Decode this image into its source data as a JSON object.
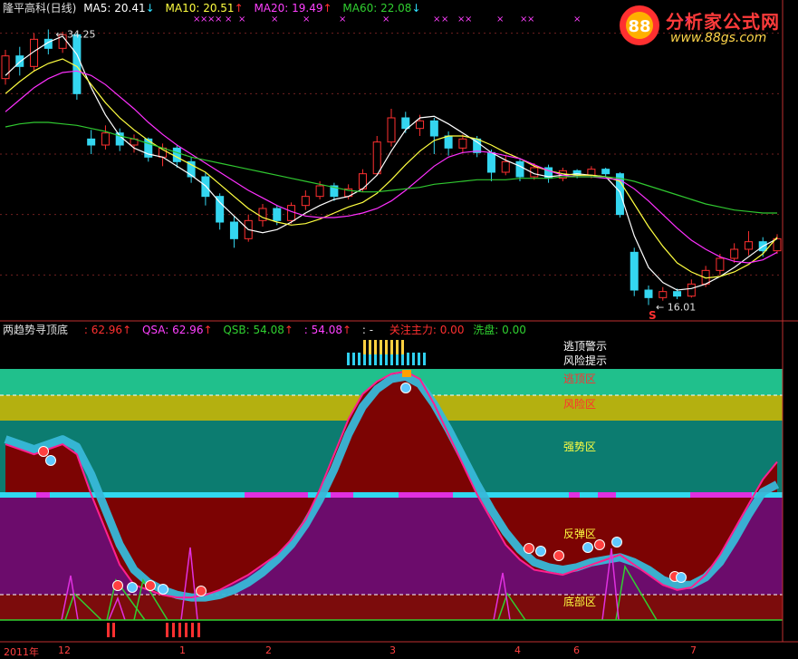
{
  "top_header": {
    "name": "隆平高科(日线)",
    "ma5_label": "MA5: 20.41",
    "ma5_arrow": "↓",
    "ma10_label": "MA10: 20.51",
    "ma10_arrow": "↑",
    "ma20_label": "MA20: 19.49",
    "ma20_arrow": "↑",
    "ma60_label": "MA60: 22.08",
    "ma60_arrow": "↓"
  },
  "logo": {
    "title": "分析家公式网",
    "url": "www.88gs.com",
    "mark_char": "88"
  },
  "top_marks": {
    "high_label": "34.25",
    "low_label": "16.01",
    "s_mark": "S"
  },
  "sub_header": {
    "name": "两趋势寻顶底",
    "v1_label": ": 62.96",
    "v1_arrow": "↑",
    "qsa_label": "QSA: 62.96",
    "qsa_arrow": "↑",
    "qsb_label": "QSB: 54.08",
    "qsb_arrow": "↑",
    "v4_label": ": 54.08",
    "v4_arrow": "↑",
    "v5_label": ": -",
    "focus_label": "关注主力: 0.00",
    "wash_label": "洗盘: 0.00"
  },
  "zones": {
    "escape_top_warning": "逃顶警示",
    "risk_hint": "风险提示",
    "escape_zone": "逃顶区",
    "risk_zone": "风险区",
    "strong_zone": "强势区",
    "rebound_zone": "反弹区",
    "bottom_zone": "底部区"
  },
  "x_axis": {
    "labels": [
      "2011年",
      "12",
      "1",
      "2",
      "3",
      "4",
      "6",
      "7"
    ]
  },
  "colors": {
    "candle_up": "#ff3030",
    "candle_down": "#34d6f0",
    "ma5": "#ffffff",
    "ma10": "#ffff40",
    "ma20": "#ff30ff",
    "ma60": "#30c830",
    "zone_escape": "#20c08c",
    "zone_risk": "#b4b010",
    "zone_strong": "#0c7c70",
    "zone_rebound": "#6c0c6c",
    "zone_bottom": "#7c0c0c",
    "fill_gray": "#454545",
    "fill_red": "#800000",
    "qsa_line": "#ff2090",
    "qsb_band": "#38b8d8",
    "green_line": "#30d030"
  },
  "chart_data": [
    {
      "type": "candlestick",
      "series": [
        {
          "name": "MA5",
          "values": [
            31.2,
            32.1,
            32.8,
            33.4,
            33.8,
            32.6,
            30.4,
            28.6,
            27.2,
            26.4,
            26.0,
            25.8,
            25.2,
            24.6,
            23.9,
            22.8,
            21.9,
            21.0,
            20.8,
            21.0,
            21.5,
            22.1,
            22.6,
            23.0,
            23.2,
            23.7,
            24.6,
            26.2,
            27.6,
            28.4,
            28.5,
            28.0,
            27.4,
            26.8,
            26.1,
            25.6,
            25.2,
            24.7,
            24.5,
            24.6,
            24.7,
            24.6,
            24.5,
            23.5,
            20.6,
            18.5,
            17.5,
            17.0,
            17.1,
            17.4,
            17.9,
            18.5,
            19.2,
            19.9,
            20.4
          ]
        },
        {
          "name": "MA10",
          "values": [
            30.0,
            30.8,
            31.5,
            32.0,
            32.3,
            31.8,
            30.6,
            29.4,
            28.4,
            27.6,
            26.9,
            26.3,
            25.8,
            25.3,
            24.8,
            24.0,
            23.2,
            22.4,
            21.8,
            21.5,
            21.3,
            21.4,
            21.7,
            22.1,
            22.5,
            22.8,
            23.4,
            24.3,
            25.3,
            26.2,
            26.9,
            27.2,
            27.2,
            27.0,
            26.6,
            26.1,
            25.7,
            25.2,
            24.9,
            24.7,
            24.6,
            24.6,
            24.5,
            24.2,
            22.7,
            21.2,
            19.9,
            18.8,
            18.2,
            17.8,
            17.9,
            18.2,
            18.7,
            19.4,
            20.5
          ]
        },
        {
          "name": "MA20",
          "values": [
            28.8,
            29.6,
            30.4,
            31.0,
            31.4,
            31.5,
            31.2,
            30.6,
            29.8,
            29.0,
            28.1,
            27.3,
            26.6,
            26.0,
            25.4,
            24.8,
            24.2,
            23.6,
            23.1,
            22.6,
            22.2,
            21.9,
            21.8,
            21.8,
            21.9,
            22.1,
            22.4,
            22.9,
            23.6,
            24.4,
            25.2,
            25.8,
            26.1,
            26.2,
            26.1,
            25.9,
            25.7,
            25.3,
            24.9,
            24.6,
            24.5,
            24.5,
            24.4,
            24.3,
            23.7,
            22.9,
            22.0,
            21.1,
            20.3,
            19.7,
            19.2,
            18.9,
            18.8,
            19.0,
            19.5
          ]
        },
        {
          "name": "MA60",
          "values": [
            27.8,
            28.0,
            28.1,
            28.1,
            28.0,
            27.9,
            27.7,
            27.5,
            27.2,
            27.0,
            26.7,
            26.4,
            26.1,
            25.8,
            25.6,
            25.4,
            25.2,
            25.0,
            24.8,
            24.6,
            24.4,
            24.2,
            24.0,
            23.8,
            23.6,
            23.5,
            23.5,
            23.6,
            23.7,
            23.8,
            24.0,
            24.1,
            24.2,
            24.3,
            24.3,
            24.3,
            24.4,
            24.4,
            24.4,
            24.5,
            24.5,
            24.5,
            24.5,
            24.4,
            24.2,
            23.9,
            23.6,
            23.3,
            23.0,
            22.7,
            22.5,
            22.3,
            22.2,
            22.1,
            22.1
          ]
        }
      ],
      "candles": [
        [
          31.0,
          32.5,
          30.6,
          32.9
        ],
        [
          32.5,
          31.8,
          31.2,
          33.1
        ],
        [
          31.8,
          33.6,
          31.5,
          34.0
        ],
        [
          33.6,
          33.0,
          32.6,
          34.25
        ],
        [
          33.0,
          33.9,
          32.7,
          34.1
        ],
        [
          33.9,
          30.0,
          29.6,
          34.0
        ],
        [
          27.0,
          26.6,
          26.0,
          27.6
        ],
        [
          26.6,
          27.4,
          26.3,
          27.9
        ],
        [
          27.4,
          26.6,
          26.2,
          27.7
        ],
        [
          26.6,
          27.0,
          26.1,
          27.3
        ],
        [
          27.0,
          25.8,
          25.5,
          27.1
        ],
        [
          25.8,
          26.4,
          25.2,
          26.7
        ],
        [
          26.4,
          25.5,
          25.1,
          26.6
        ],
        [
          25.5,
          24.5,
          24.1,
          25.8
        ],
        [
          24.5,
          23.2,
          22.6,
          24.8
        ],
        [
          23.2,
          21.5,
          21.0,
          23.4
        ],
        [
          21.5,
          20.4,
          19.8,
          21.9
        ],
        [
          20.4,
          21.6,
          20.2,
          22.0
        ],
        [
          21.6,
          22.4,
          21.2,
          22.7
        ],
        [
          22.4,
          21.6,
          21.3,
          22.6
        ],
        [
          21.6,
          22.6,
          21.4,
          22.8
        ],
        [
          22.6,
          23.2,
          22.3,
          23.6
        ],
        [
          23.2,
          23.9,
          23.0,
          24.2
        ],
        [
          23.9,
          23.2,
          22.9,
          24.1
        ],
        [
          23.2,
          23.7,
          23.0,
          24.0
        ],
        [
          23.7,
          24.7,
          23.5,
          25.0
        ],
        [
          24.7,
          26.8,
          24.6,
          27.2
        ],
        [
          26.8,
          28.4,
          26.5,
          29.0
        ],
        [
          28.4,
          27.7,
          27.4,
          28.8
        ],
        [
          27.7,
          28.2,
          27.2,
          28.6
        ],
        [
          28.2,
          27.2,
          26.0,
          28.4
        ],
        [
          27.2,
          26.4,
          25.9,
          27.5
        ],
        [
          26.4,
          27.0,
          26.1,
          27.3
        ],
        [
          27.0,
          26.1,
          25.8,
          27.2
        ],
        [
          26.1,
          24.8,
          24.2,
          26.3
        ],
        [
          24.8,
          25.5,
          24.6,
          25.9
        ],
        [
          25.5,
          24.5,
          24.2,
          25.7
        ],
        [
          24.5,
          25.1,
          24.3,
          25.4
        ],
        [
          25.1,
          24.4,
          24.1,
          25.3
        ],
        [
          24.4,
          24.9,
          24.2,
          25.1
        ],
        [
          24.9,
          24.6,
          24.4,
          25.0
        ],
        [
          24.6,
          25.0,
          24.4,
          25.2
        ],
        [
          25.0,
          24.7,
          24.5,
          25.1
        ],
        [
          24.7,
          22.0,
          21.8,
          24.8
        ],
        [
          19.5,
          17.0,
          16.6,
          19.8
        ],
        [
          17.0,
          16.5,
          16.01,
          17.3
        ],
        [
          16.5,
          16.9,
          16.3,
          17.2
        ],
        [
          16.9,
          16.6,
          16.4,
          17.1
        ],
        [
          16.6,
          17.4,
          16.5,
          17.7
        ],
        [
          17.4,
          18.3,
          17.2,
          18.6
        ],
        [
          18.3,
          19.1,
          18.0,
          19.4
        ],
        [
          19.1,
          19.7,
          18.8,
          20.1
        ],
        [
          19.7,
          20.2,
          19.3,
          20.9
        ],
        [
          20.2,
          19.6,
          19.2,
          20.5
        ],
        [
          19.6,
          20.4,
          19.4,
          20.7
        ]
      ],
      "ylim": [
        15.5,
        35.0
      ],
      "annotations": [
        "34.25",
        "16.01"
      ]
    },
    {
      "type": "line",
      "ylim": [
        0,
        100
      ],
      "series": [
        {
          "name": "QSA",
          "values": [
            70,
            68,
            66,
            68,
            70,
            66,
            50,
            36,
            22,
            14,
            12,
            10,
            9,
            9,
            10,
            12,
            15,
            18,
            22,
            26,
            32,
            40,
            52,
            66,
            80,
            90,
            95,
            98,
            99,
            96,
            86,
            74,
            62,
            50,
            40,
            30,
            24,
            20,
            19,
            18,
            20,
            22,
            24,
            26,
            22,
            18,
            14,
            12,
            13,
            18,
            26,
            36,
            46,
            56,
            63
          ]
        },
        {
          "name": "QSB",
          "values": [
            72,
            70,
            68,
            70,
            72,
            69,
            58,
            44,
            30,
            20,
            15,
            12,
            10,
            9,
            9,
            10,
            12,
            15,
            19,
            24,
            30,
            38,
            48,
            60,
            74,
            85,
            92,
            96,
            97,
            94,
            86,
            76,
            65,
            54,
            44,
            35,
            28,
            23,
            21,
            20,
            21,
            23,
            24,
            25,
            23,
            20,
            16,
            14,
            14,
            17,
            23,
            32,
            42,
            51,
            54
          ]
        }
      ]
    }
  ]
}
